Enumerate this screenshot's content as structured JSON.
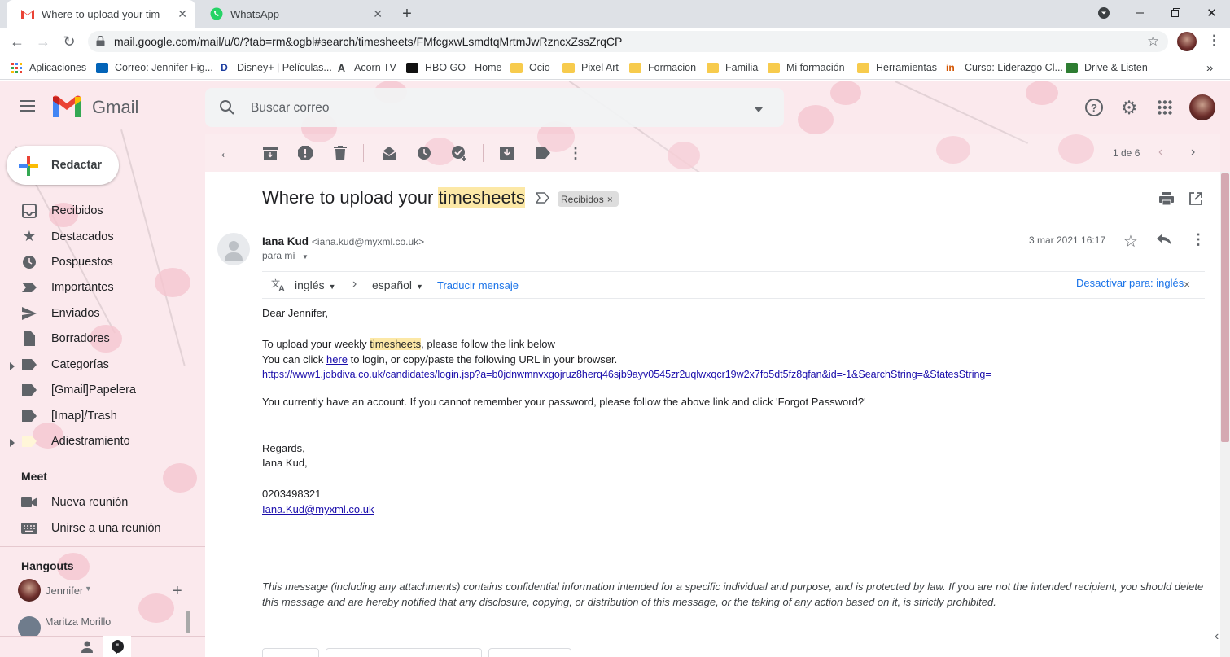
{
  "browser": {
    "tabs": [
      {
        "title": "Where to upload your timesheets",
        "favicon": "gmail-icon"
      },
      {
        "title": "WhatsApp",
        "favicon": "whatsapp-icon"
      }
    ],
    "url": "mail.google.com/mail/u/0/?tab=rm&ogbl#search/timesheets/FMfcgxwLsmdtqMrtmJwRzncxZssZrqCP",
    "bookmarks": [
      {
        "label": "Aplicaciones",
        "icon": "apps-grid-icon"
      },
      {
        "label": "Correo: Jennifer Fig...",
        "icon": "outlook-icon"
      },
      {
        "label": "Disney+ | Películas...",
        "icon": "disney-icon"
      },
      {
        "label": "Acorn TV",
        "icon": "acorn-icon"
      },
      {
        "label": "HBO GO - Home",
        "icon": "hbo-icon"
      },
      {
        "label": "Ocio",
        "icon": "folder-icon"
      },
      {
        "label": "Pixel Art",
        "icon": "folder-icon"
      },
      {
        "label": "Formacion",
        "icon": "folder-icon"
      },
      {
        "label": "Familia",
        "icon": "folder-icon"
      },
      {
        "label": "Mi formación",
        "icon": "folder-icon"
      },
      {
        "label": "Herramientas",
        "icon": "folder-icon"
      },
      {
        "label": "Curso: Liderazgo Cl...",
        "icon": "course-icon"
      },
      {
        "label": "Drive & Listen",
        "icon": "drive-listen-icon"
      }
    ],
    "more_bookmarks": "»"
  },
  "gmail": {
    "brand": "Gmail",
    "search_placeholder": "Buscar correo",
    "compose_label": "Redactar",
    "nav": [
      {
        "label": "Recibidos",
        "icon": "inbox-icon"
      },
      {
        "label": "Destacados",
        "icon": "star-icon"
      },
      {
        "label": "Pospuestos",
        "icon": "clock-icon"
      },
      {
        "label": "Importantes",
        "icon": "important-icon"
      },
      {
        "label": "Enviados",
        "icon": "send-icon"
      },
      {
        "label": "Borradores",
        "icon": "draft-icon"
      },
      {
        "label": "Categorías",
        "icon": "label-icon"
      },
      {
        "label": "[Gmail]Papelera",
        "icon": "label-icon"
      },
      {
        "label": "[Imap]/Trash",
        "icon": "label-icon"
      },
      {
        "label": "Adiestramiento",
        "icon": "label-icon"
      }
    ],
    "meet": {
      "heading": "Meet",
      "items": [
        {
          "label": "Nueva reunión",
          "icon": "video-icon"
        },
        {
          "label": "Unirse a una reunión",
          "icon": "keyboard-icon"
        }
      ]
    },
    "hangouts": {
      "heading": "Hangouts",
      "user": "Jennifer",
      "contact": "Maritza Morillo"
    },
    "pagination": "1 de 6",
    "email": {
      "subject_pre": "Where to upload your ",
      "subject_hl": "timesheets",
      "label_chip": "Recibidos",
      "sender_name": "Iana Kud",
      "sender_email": "<iana.kud@myxml.co.uk>",
      "to": "para mí",
      "date": "3 mar 2021 16:17",
      "translate": {
        "from": "inglés",
        "to": "español",
        "action": "Traducir mensaje",
        "disable": "Desactivar para: inglés"
      },
      "greeting": "Dear Jennifer,",
      "line1_pre": "To upload your weekly ",
      "line1_hl": "timesheets",
      "line1_post": ", please follow the link below",
      "line2_pre": "You can click ",
      "line2_link": "here",
      "line2_post": " to login, or copy/paste the following URL in your browser.",
      "long_link": "https://www1.jobdiva.co.uk/candidates/login.jsp?a=b0jdnwmnvxgojruz8herq46sjb9ayv0545zr2uqlwxqcr19w2x7fo5dt5fz8qfan&id=-1&SearchString=&StatesString=",
      "account_line": "You currently have an account. If you cannot remember your password, please follow the above link and click 'Forgot Password?'",
      "regards": "Regards,",
      "signature_name": "Iana Kud,",
      "phone": "0203498321",
      "sig_email": "Iana.Kud@myxml.co.uk",
      "disclaimer_1": "This message (including any attachments) contains confidential information intended for a specific individual and purpose, and is protected by law. If you are not the intended recipient, you should delete",
      "disclaimer_2": "this message and are hereby notified that any disclosure, copying, or distribution of this message, or the taking of any action based on it, is strictly prohibited."
    }
  }
}
